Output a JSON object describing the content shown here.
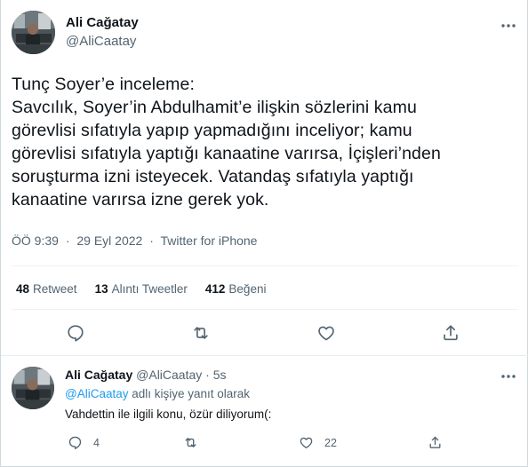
{
  "tweet": {
    "author_name": "Ali Cağatay",
    "author_handle": "@AliCaatay",
    "lines": [
      "Tunç Soyer’e inceleme:",
      "Savcılık, Soyer’in Abdulhamit’e ilişkin sözlerini kamu",
      "görevlisi sıfatıyla yapıp yapmadığını inceliyor; kamu",
      "görevlisi sıfatıyla yaptığı kanaatine varırsa, İçişleri’nden",
      "soruşturma izni isteyecek. Vatandaş sıfatıyla yaptığı",
      "kanaatine varırsa izne gerek yok."
    ],
    "time": "ÖÖ 9:39",
    "date": "29 Eyl 2022",
    "source": "Twitter for iPhone",
    "separator": "·",
    "stats": {
      "retweets_count": "48",
      "retweets_label": "Retweet",
      "quotes_count": "13",
      "quotes_label": "Alıntı Tweetler",
      "likes_count": "412",
      "likes_label": "Beğeni"
    },
    "actions": [
      "reply-icon",
      "retweet-icon",
      "like-icon",
      "share-icon"
    ]
  },
  "reply": {
    "author_name": "Ali Cağatay",
    "author_handle": "@AliCaatay",
    "separator": "·",
    "age": "5s",
    "reply_to_mention": "@AliCaatay",
    "reply_to_suffix": " adlı kişiye yanıt olarak",
    "text": "Vahdettin ile ilgili konu, özür diliyorum(:",
    "reply_count": "4",
    "like_count": "22"
  },
  "colors": {
    "text": "#0f1419",
    "secondary": "#536471",
    "accent": "#1d9bf0",
    "divider": "#eff3f4"
  }
}
